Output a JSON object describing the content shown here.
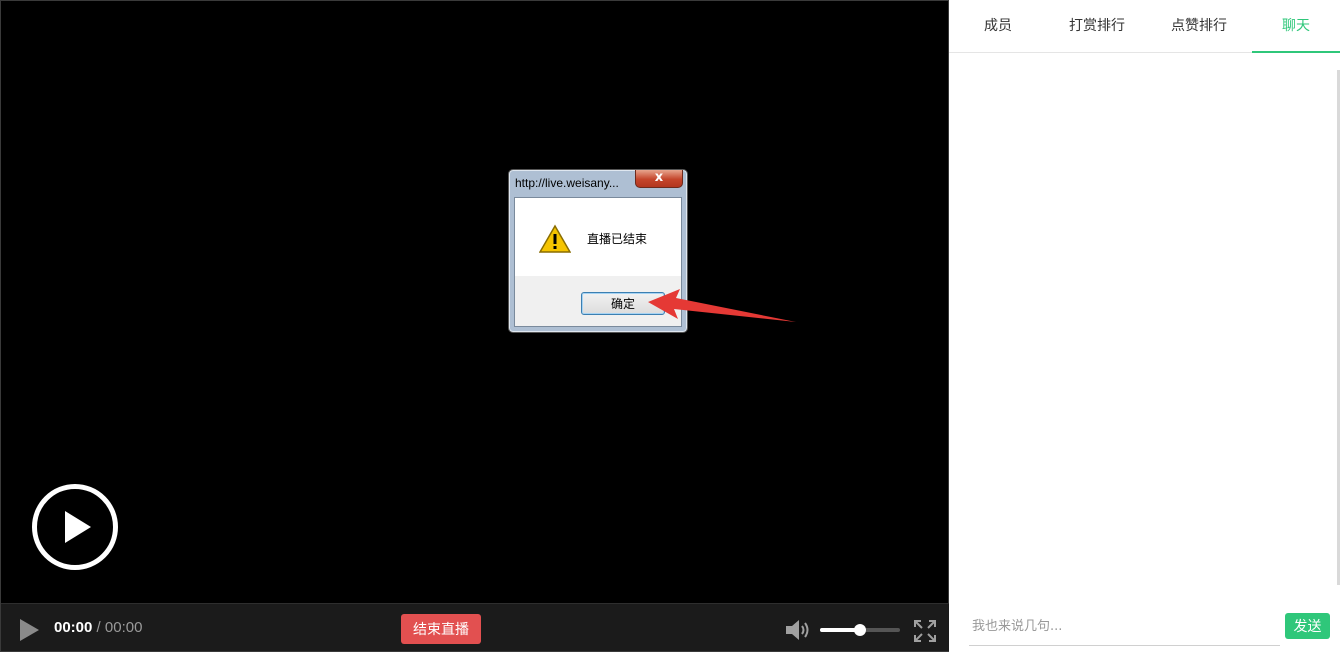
{
  "player": {
    "current_time": "00:00",
    "separator": "/",
    "duration": "00:00",
    "end_live_label": "结束直播",
    "volume_fraction": 0.5,
    "play_icon": "play-icon",
    "volume_icon": "speaker-icon",
    "fullscreen_icon": "fullscreen-icon"
  },
  "dialog": {
    "title": "http://live.weisany...",
    "close_label": "x",
    "message": "直播已结束",
    "ok_label": "确定",
    "icon": "warning-icon"
  },
  "tabs": [
    {
      "label": "成员"
    },
    {
      "label": "打赏排行"
    },
    {
      "label": "点赞排行"
    },
    {
      "label": "聊天"
    }
  ],
  "active_tab": 3,
  "chat": {
    "placeholder": "我也来说几句...",
    "send_label": "发送"
  },
  "colors": {
    "accent": "#2fc77a",
    "end_live": "#e25050",
    "annotation_arrow": "#e53935"
  }
}
